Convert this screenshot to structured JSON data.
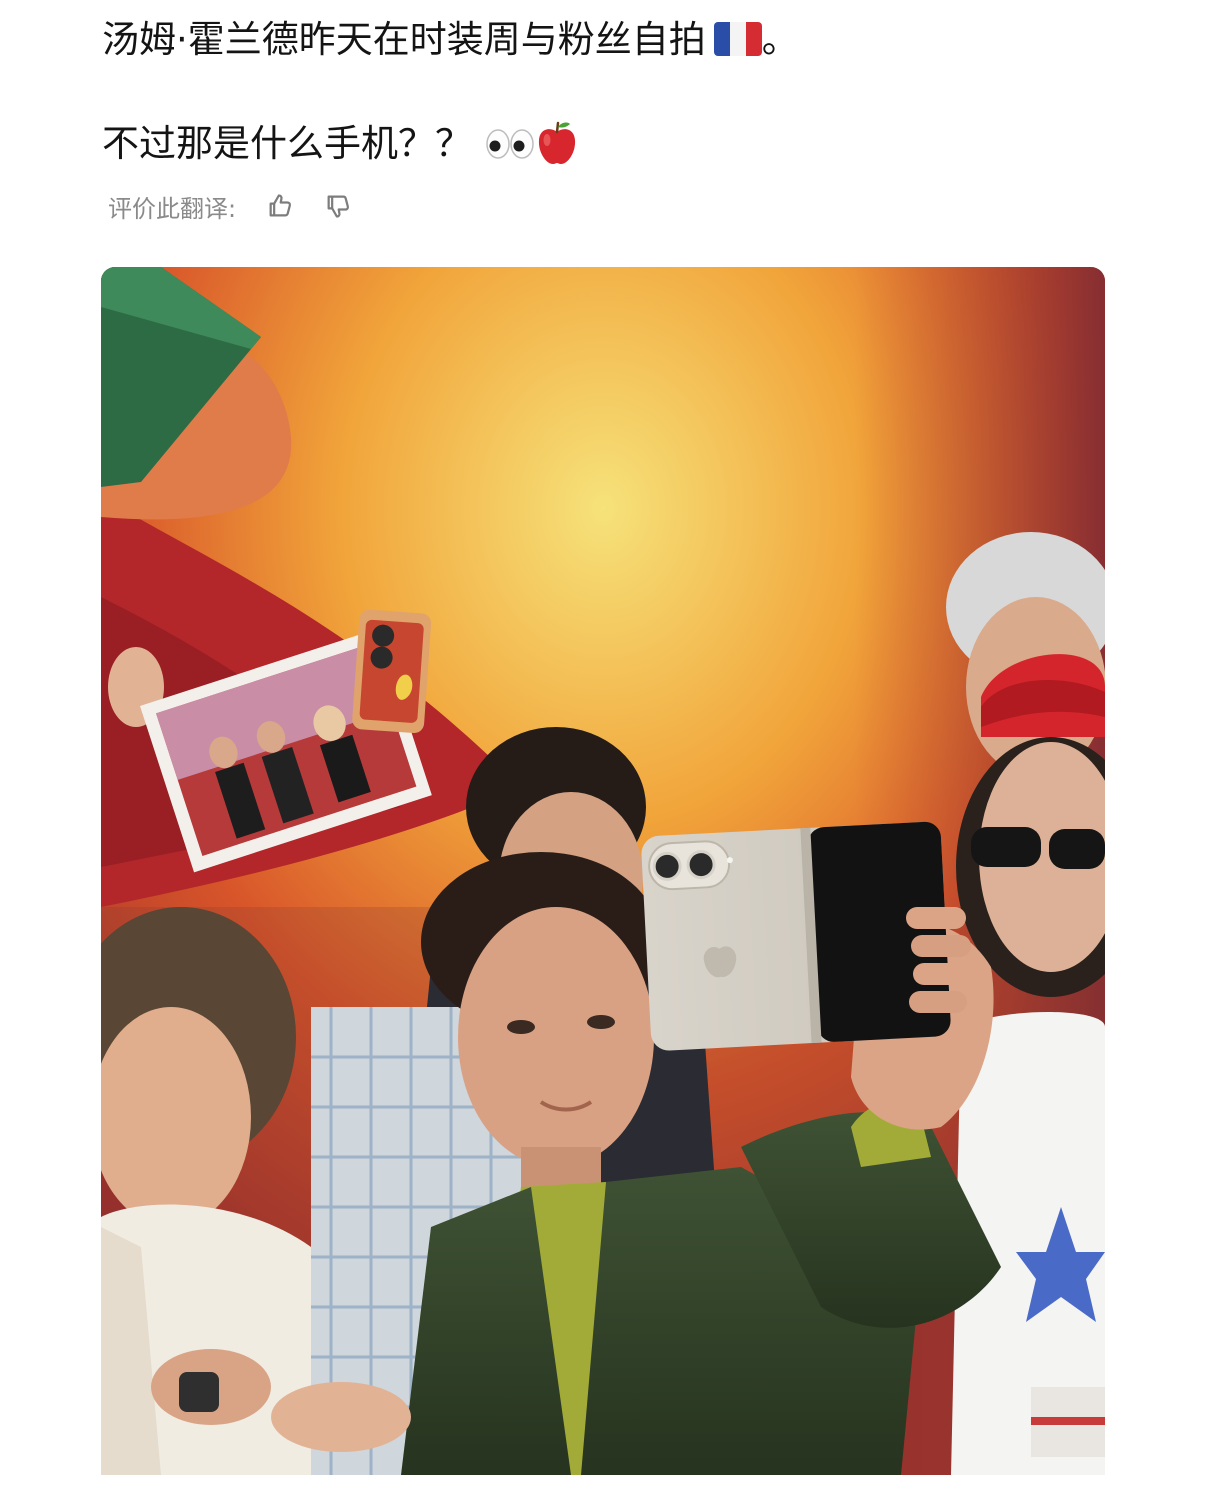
{
  "post": {
    "line1": "汤姆·霍兰德昨天在时装周与粉丝自拍",
    "line1_end": "。",
    "line2": "不过那是什么手机？？",
    "flag_icon": "france-flag-icon",
    "eyes_icon": "eyes-icon",
    "apple_icon": "red-apple-icon"
  },
  "translation": {
    "label": "评价此翻译:",
    "thumb_up_icon": "thumb-up-icon",
    "thumb_down_icon": "thumb-down-icon"
  },
  "colors": {
    "text": "#141414",
    "muted": "#8a8a8a",
    "flag_blue": "#2a4ea8",
    "flag_white": "#f4f4f4",
    "flag_red": "#d52b33"
  }
}
